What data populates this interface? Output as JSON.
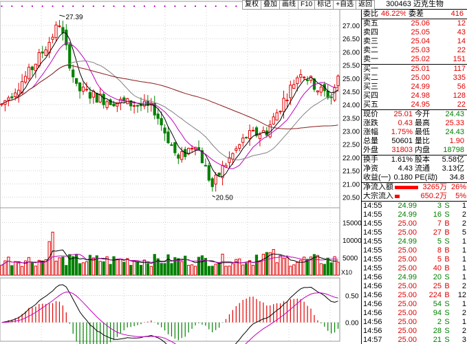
{
  "toolbar": {
    "buttons": [
      "复权",
      "叠加",
      "画线",
      "F10",
      "标记",
      "+自选",
      "返回"
    ]
  },
  "chart": {
    "high_marker": "27.39",
    "low_marker": "20.50",
    "price_ticks": [
      "27.00",
      "26.50",
      "26.00",
      "25.50",
      "25.00",
      "24.50",
      "24.00",
      "23.50",
      "23.00",
      "22.50",
      "22.00",
      "21.50",
      "21.00",
      "20.50"
    ],
    "price_range": [
      20.2,
      27.6
    ],
    "volume_ticks": [
      "15000",
      "10000",
      "5000"
    ],
    "volume_unit": "X10",
    "volume_range": [
      0,
      18000
    ],
    "macd_ticks": [
      "0.50",
      "0.00"
    ],
    "macd_range": [
      -0.35,
      0.75
    ],
    "colors": {
      "up": "#e00000",
      "down": "#008000",
      "ma5": "#000000",
      "ma10": "#c000c0",
      "ma20": "#808080",
      "ma60": "#8b1a1a",
      "grid": "#d0d0d0"
    }
  },
  "panel": {
    "stock_title": "300463 迈克生物",
    "weibi": {
      "label": "委比",
      "value": "46.22%",
      "label2": "委差",
      "value2": "416"
    },
    "asks": [
      {
        "label": "卖五",
        "price": "25.06",
        "vol": "12"
      },
      {
        "label": "卖四",
        "price": "25.05",
        "vol": "43"
      },
      {
        "label": "卖三",
        "price": "25.04",
        "vol": "14"
      },
      {
        "label": "卖二",
        "price": "25.03",
        "vol": "22"
      },
      {
        "label": "卖一",
        "price": "25.02",
        "vol": "151"
      }
    ],
    "bids": [
      {
        "label": "买一",
        "price": "25.01",
        "vol": "117"
      },
      {
        "label": "买二",
        "price": "25.00",
        "vol": "335"
      },
      {
        "label": "买三",
        "price": "24.99",
        "vol": "56"
      },
      {
        "label": "买四",
        "price": "24.98",
        "vol": "128"
      },
      {
        "label": "买五",
        "price": "24.95",
        "vol": "22"
      }
    ],
    "quote": [
      [
        {
          "l": "现价",
          "v": "25.01",
          "c": "red"
        },
        {
          "l": "今开",
          "v": "24.43",
          "c": "green"
        }
      ],
      [
        {
          "l": "涨跌",
          "v": "0.43",
          "c": "red"
        },
        {
          "l": "最高",
          "v": "25.33",
          "c": "red"
        }
      ],
      [
        {
          "l": "涨幅",
          "v": "1.75%",
          "c": "red"
        },
        {
          "l": "最低",
          "v": "24.43",
          "c": "green"
        }
      ],
      [
        {
          "l": "总量",
          "v": "50601",
          "c": ""
        },
        {
          "l": "量比",
          "v": "1.90",
          "c": "red"
        }
      ],
      [
        {
          "l": "外盘",
          "v": "31803",
          "c": "red"
        },
        {
          "l": "内盘",
          "v": "18798",
          "c": "green"
        }
      ]
    ],
    "stats": [
      [
        {
          "l": "换手",
          "v": "1.61%"
        },
        {
          "l": "股本",
          "v": "5.58亿"
        }
      ],
      [
        {
          "l": "净资",
          "v": "4.43"
        },
        {
          "l": "流通",
          "v": "3.13亿"
        }
      ]
    ],
    "eps": {
      "l": "收益(一)",
      "v": "0.180",
      "l2": "PE(动)",
      "v2": "34.8"
    },
    "flows": [
      {
        "label": "净流入额",
        "value": "3265万",
        "pct": "26%",
        "bar": 26
      },
      {
        "label": "大宗流入",
        "value": "650.2万",
        "pct": "5%",
        "bar": 5
      }
    ],
    "ticks": [
      {
        "t": "14:55",
        "p": "24.99",
        "v": "3",
        "s": "S",
        "n": "1",
        "pc": "green",
        "vc": "green"
      },
      {
        "t": "14:55",
        "p": "24.99",
        "v": "16",
        "s": "S",
        "n": "2",
        "pc": "green",
        "vc": "green"
      },
      {
        "t": "14:55",
        "p": "25.00",
        "v": "7",
        "s": "B",
        "n": "2",
        "pc": "red",
        "vc": "red"
      },
      {
        "t": "14:55",
        "p": "25.00",
        "v": "27",
        "s": "B",
        "n": "5",
        "pc": "red",
        "vc": "red"
      },
      {
        "t": "14:55",
        "p": "24.99",
        "v": "5",
        "s": "S",
        "n": "1",
        "pc": "green",
        "vc": "green"
      },
      {
        "t": "14:55",
        "p": "25.00",
        "v": "8",
        "s": "B",
        "n": "1",
        "pc": "red",
        "vc": "red"
      },
      {
        "t": "14:55",
        "p": "25.00",
        "v": "5",
        "s": "B",
        "n": "1",
        "pc": "red",
        "vc": "red"
      },
      {
        "t": "14:55",
        "p": "25.00",
        "v": "40",
        "s": "B",
        "n": "1",
        "pc": "red",
        "vc": "red"
      },
      {
        "t": "14:56",
        "p": "24.99",
        "v": "20",
        "s": "S",
        "n": "1",
        "pc": "green",
        "vc": "green"
      },
      {
        "t": "14:56",
        "p": "25.00",
        "v": "25",
        "s": "B",
        "n": "2",
        "pc": "red",
        "vc": "red"
      },
      {
        "t": "14:56",
        "p": "25.00",
        "v": "224",
        "s": "B",
        "n": "12",
        "pc": "red",
        "vc": "red"
      },
      {
        "t": "14:56",
        "p": "25.00",
        "v": "54",
        "s": "S",
        "n": "1",
        "pc": "red",
        "vc": "green"
      },
      {
        "t": "14:56",
        "p": "25.00",
        "v": "94",
        "s": "S",
        "n": "2",
        "pc": "red",
        "vc": "green"
      },
      {
        "t": "14:56",
        "p": "25.00",
        "v": "2",
        "s": "S",
        "n": "1",
        "pc": "red",
        "vc": "green"
      },
      {
        "t": "14:56",
        "p": "25.00",
        "v": "28",
        "s": "S",
        "n": "2",
        "pc": "red",
        "vc": "green"
      },
      {
        "t": "14:57",
        "p": "25.00",
        "v": "21",
        "s": "S",
        "n": "3",
        "pc": "red",
        "vc": "green"
      }
    ]
  }
}
